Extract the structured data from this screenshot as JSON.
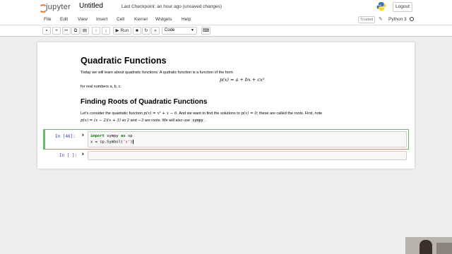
{
  "header": {
    "logo_text": "jupyter",
    "notebook_title": "Untitled",
    "checkpoint_status": "Last Checkpoint: an hour ago  (unsaved changes)",
    "logout_label": "Logout"
  },
  "menu": {
    "items": [
      "File",
      "Edit",
      "View",
      "Insert",
      "Cell",
      "Kernel",
      "Widgets",
      "Help"
    ],
    "trusted_label": "Trusted",
    "kernel_name": "Python 3"
  },
  "toolbar": {
    "run_label": "Run",
    "cell_type": "Code",
    "icons": [
      "save-icon",
      "plus-icon",
      "cut-icon",
      "copy-icon",
      "paste-icon",
      "arrow-up-icon",
      "arrow-down-icon",
      "run-icon",
      "stop-icon",
      "restart-icon",
      "fast-forward-icon",
      "keyboard-icon"
    ]
  },
  "markdown": {
    "title": "Quadratic Functions",
    "intro": "Today we will learn about quadratic functions. A qudratic function is a function of the form",
    "formula": "p(x) = a + bx + cx²",
    "real_numbers": "for real numbers a, b, c.",
    "subtitle": "Finding Roots of Quadratic Functions",
    "para1_a": "Let's consider the quadratic function ",
    "para1_math1": "p(x) = x² + x − 6",
    "para1_b": ". And we want to find the solutions to ",
    "para1_math2": "p(x) = 0",
    "para1_c": "; these are called the roots. First, note",
    "para2_math": "p(x) = (x − 2)(x + 3)",
    "para2_a": " so 2 and ",
    "para2_math2": "−3",
    "para2_b": " are roots. We will also use ",
    "para2_code": "sympy",
    "para2_end": " ."
  },
  "cells": [
    {
      "prompt": "In [46]:",
      "lines": [
        {
          "kw": "import",
          "rest1": " sympy ",
          "kw2": "as",
          "rest2": " sp"
        },
        {
          "plain": "x = sp.Symbol(",
          "str": "'x'",
          "end": ")"
        }
      ]
    },
    {
      "prompt": "In [ ]:"
    }
  ]
}
